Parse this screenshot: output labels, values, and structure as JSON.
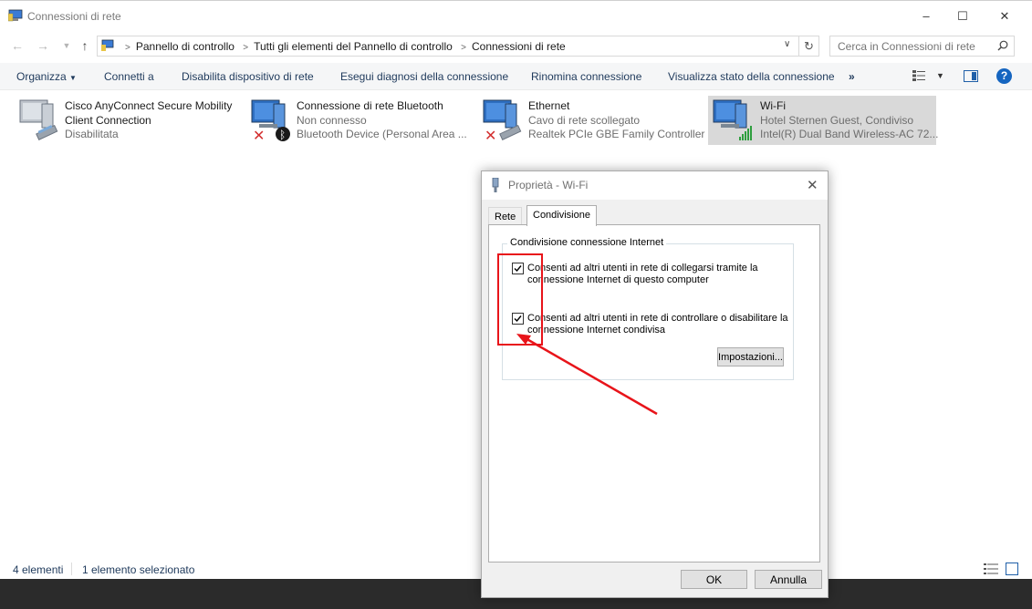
{
  "window": {
    "title": "Connessioni di rete",
    "controls": {
      "minimize": "–",
      "maximize": "☐",
      "close": "✕"
    }
  },
  "addressbar": {
    "crumbs": [
      "Pannello di controllo",
      "Tutti gli elementi del Pannello di controllo",
      "Connessioni di rete"
    ],
    "search_placeholder": "Cerca in Connessioni di rete"
  },
  "commandbar": {
    "organize": "Organizza",
    "connect": "Connetti a",
    "disable": "Disabilita dispositivo di rete",
    "diagnose": "Esegui diagnosi della connessione",
    "rename": "Rinomina connessione",
    "status": "Visualizza stato della connessione",
    "more": "»",
    "help": "?"
  },
  "connections": [
    {
      "name_1": "Cisco AnyConnect Secure Mobility",
      "name_2": "Client Connection",
      "status": "Disabilitata",
      "icon": "network-adapter-icon"
    },
    {
      "name": "Connessione di rete Bluetooth",
      "status": "Non connesso",
      "device": "Bluetooth Device (Personal Area ...",
      "icon": "bluetooth-adapter-icon"
    },
    {
      "name": "Ethernet",
      "status": "Cavo di rete scollegato",
      "device": "Realtek PCIe GBE Family Controller",
      "icon": "ethernet-adapter-icon"
    },
    {
      "name": "Wi-Fi",
      "status": "Hotel Sternen Guest, Condiviso",
      "device": "Intel(R) Dual Band Wireless-AC 72...",
      "icon": "wifi-adapter-icon"
    }
  ],
  "statusbar": {
    "count": "4 elementi",
    "selected": "1 elemento selezionato"
  },
  "dialog": {
    "title": "Proprietà - Wi-Fi",
    "close": "✕",
    "tabs": [
      "Rete",
      "Condivisione"
    ],
    "group_title": "Condivisione connessione Internet",
    "option_1": "Consenti ad altri utenti in rete di collegarsi tramite la connessione Internet di questo computer",
    "option_1_checked": true,
    "option_2": "Consenti ad altri utenti in rete di controllare o disabilitare la connessione Internet condivisa",
    "option_2_checked": true,
    "settings_button": "Impostazioni...",
    "ok_button": "OK",
    "cancel_button": "Annulla"
  },
  "colors": {
    "accent": "#1e395b",
    "selection": "#d9d9d9",
    "annotation": "#e8141a"
  }
}
